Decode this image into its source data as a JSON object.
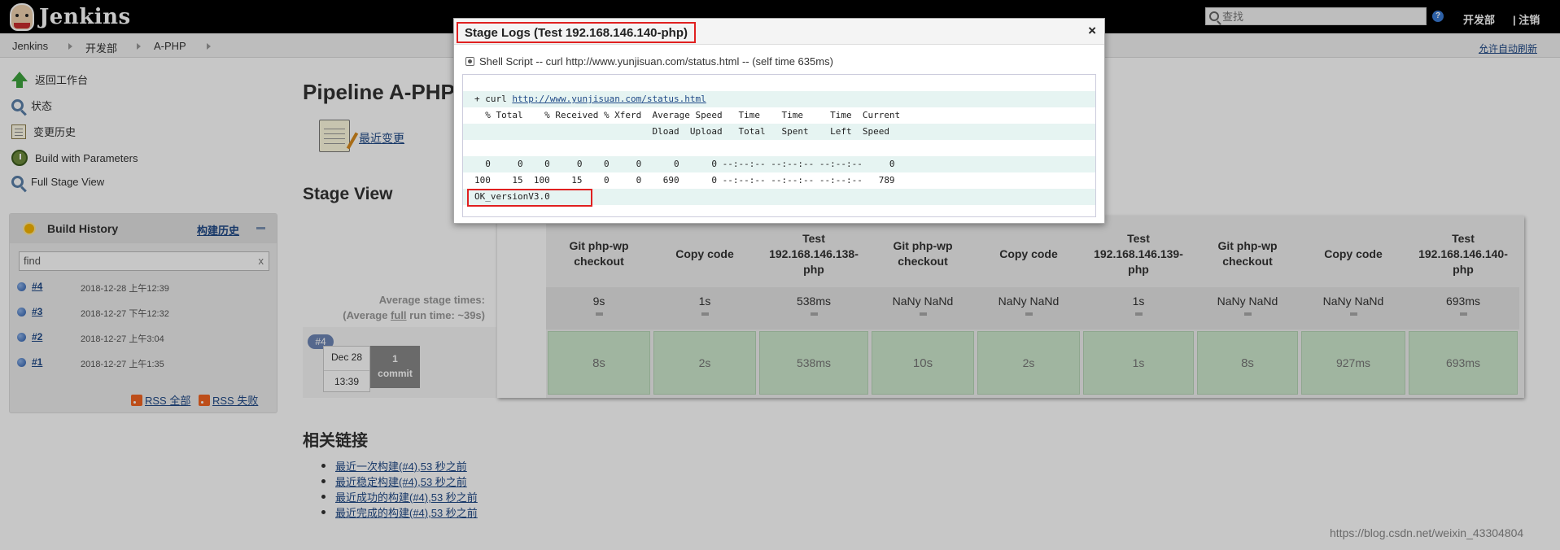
{
  "header": {
    "logo_text": "Jenkins",
    "search_placeholder": "查找",
    "help": "?",
    "user": "开发部",
    "logout": "| 注销"
  },
  "breadcrumb": {
    "items": [
      "Jenkins",
      "开发部",
      "A-PHP"
    ],
    "auto_refresh": "允许自动刷新"
  },
  "sidebar": {
    "tasks": [
      "返回工作台",
      "状态",
      "变更历史",
      "Build with Parameters",
      "Full Stage View"
    ]
  },
  "build_history": {
    "title": "Build History",
    "trend": "构建历史",
    "find_value": "find",
    "clear": "x",
    "builds": [
      {
        "num": "#4",
        "date": "2018-12-28 上午12:39"
      },
      {
        "num": "#3",
        "date": "2018-12-27 下午12:32"
      },
      {
        "num": "#2",
        "date": "2018-12-27 上午3:04"
      },
      {
        "num": "#1",
        "date": "2018-12-27 上午1:35"
      }
    ],
    "rss_all": "RSS 全部",
    "rss_failed": "RSS 失败"
  },
  "main": {
    "title": "Pipeline A-PHP",
    "recent_changes": "最近变更",
    "stage_view_title": "Stage View",
    "avg_line1": "Average stage times:",
    "avg_line2_a": "(Average ",
    "avg_line2_b": "full",
    "avg_line2_c": " run time: ~39s)",
    "run": {
      "badge": "#4",
      "date": "Dec 28",
      "time": "13:39",
      "commit_count": "1",
      "commit_label": "commit"
    },
    "stages": [
      {
        "name": "Git php-wp checkout",
        "avg": "9s",
        "result": "8s"
      },
      {
        "name": "Copy code",
        "avg": "1s",
        "result": "2s"
      },
      {
        "name": "Test 192.168.146.138-php",
        "avg": "538ms",
        "result": "538ms"
      },
      {
        "name": "Git php-wp checkout",
        "avg": "NaNy NaNd",
        "result": "10s"
      },
      {
        "name": "Copy code",
        "avg": "NaNy NaNd",
        "result": "2s"
      },
      {
        "name": "Test 192.168.146.139-php",
        "avg": "1s",
        "result": "1s"
      },
      {
        "name": "Git php-wp checkout",
        "avg": "NaNy NaNd",
        "result": "8s"
      },
      {
        "name": "Copy code",
        "avg": "NaNy NaNd",
        "result": "927ms"
      },
      {
        "name": "Test 192.168.146.140-php",
        "avg": "693ms",
        "result": "693ms"
      }
    ],
    "related_title": "相关链接",
    "permalinks": [
      "最近一次构建(#4),53 秒之前",
      "最近稳定构建(#4),53 秒之前",
      "最近成功的构建(#4),53 秒之前",
      "最近完成的构建(#4),53 秒之前"
    ]
  },
  "modal": {
    "title": "Stage Logs (Test 192.168.146.140-php)",
    "close": "×",
    "node_label": "Shell Script -- curl http://www.yunjisuan.com/status.html -- (self time 635ms)",
    "log_lines": [
      "",
      "+ curl ",
      "  % Total    % Received % Xferd  Average Speed   Time    Time     Time  Current",
      "                                 Dload  Upload   Total   Spent    Left  Speed",
      "",
      "  0     0    0     0    0     0      0      0 --:--:-- --:--:-- --:--:--     0",
      "100    15  100    15    0     0    690      0 --:--:-- --:--:-- --:--:--   789",
      "OK_versionV3.0"
    ],
    "log_url": "http://www.yunjisuan.com/status.html"
  },
  "watermark": "https://blog.csdn.net/weixin_43304804"
}
